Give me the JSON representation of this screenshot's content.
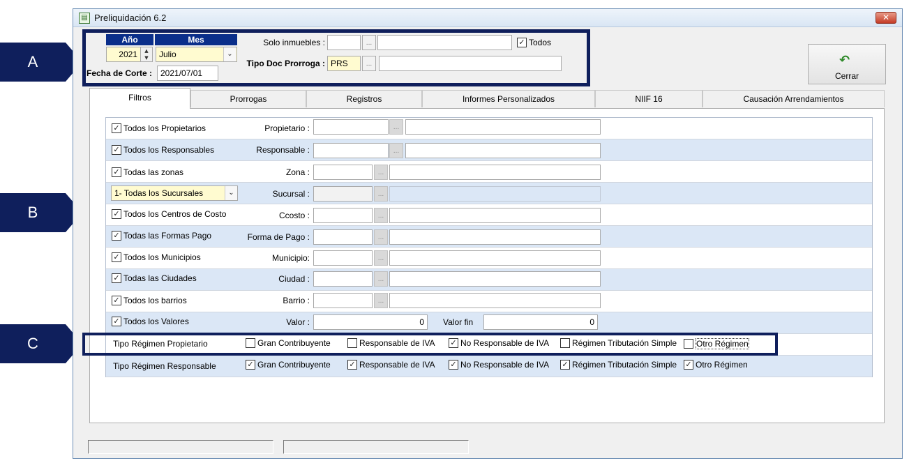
{
  "callouts": {
    "a": "A",
    "b": "B",
    "c": "C"
  },
  "window": {
    "title": "Preliquidación 6.2",
    "close_symbol": "✕"
  },
  "header": {
    "year_label": "Año",
    "month_label": "Mes",
    "year_value": "2021",
    "month_value": "Julio",
    "cutoff_label": "Fecha de Corte :",
    "cutoff_value": "2021/07/01",
    "solo_inmuebles_label": "Solo inmuebles :",
    "solo_inmuebles_code": "",
    "solo_inmuebles_name": "",
    "todos_label": "Todos",
    "tipo_doc_label": "Tipo Doc Prorroga :",
    "tipo_doc_value": "PRS",
    "tipo_doc_name": "",
    "dots": "..."
  },
  "cerrar": {
    "label": "Cerrar",
    "icon": "undo-arrow-icon"
  },
  "tabs": [
    {
      "label": "Filtros",
      "active": true
    },
    {
      "label": "Prorrogas"
    },
    {
      "label": "Registros"
    },
    {
      "label": "Informes Personalizados"
    },
    {
      "label": "NIIF 16"
    },
    {
      "label": "Causación Arrendamientos"
    }
  ],
  "filters": [
    {
      "check": "Todos los Propietarios",
      "label": "Propietario :"
    },
    {
      "check": "Todos los Responsables",
      "label": "Responsable :"
    },
    {
      "check": "Todas las zonas",
      "label": "Zona :"
    },
    {
      "combo": "1- Todas los Sucursales",
      "label": "Sucursal :"
    },
    {
      "check": "Todos los Centros de Costo",
      "label": "Ccosto :"
    },
    {
      "check": "Todas las Formas Pago",
      "label": "Forma de Pago :"
    },
    {
      "check": "Todos los Municipios",
      "label": "Municipio:"
    },
    {
      "check": "Todas las Ciudades",
      "label": "Ciudad :"
    },
    {
      "check": "Todos los barrios",
      "label": "Barrio :"
    },
    {
      "check": "Todos los Valores",
      "label": "Valor :",
      "valor_ini": "0",
      "valor_fin_label": "Valor fin",
      "valor_fin": "0"
    }
  ],
  "regimen_propietario": {
    "label": "Tipo Régimen Propietario",
    "options": [
      "Gran Contribuyente",
      "Responsable de IVA",
      "No Responsable de IVA",
      "Régimen Tributación Simple",
      "Otro Régimen"
    ],
    "checked": [
      false,
      false,
      true,
      false,
      false
    ]
  },
  "regimen_responsable": {
    "label": "Tipo Régimen Responsable",
    "options": [
      "Gran Contribuyente",
      "Responsable de IVA",
      "No Responsable de IVA",
      "Régimen Tributación Simple",
      "Otro Régimen"
    ],
    "checked": [
      true,
      true,
      true,
      true,
      true
    ]
  },
  "colors": {
    "callout": "#0f1f5c",
    "row_alt": "#dbe7f6",
    "header_blue": "#0a2e8a",
    "yellow_field": "#fffbd0"
  }
}
